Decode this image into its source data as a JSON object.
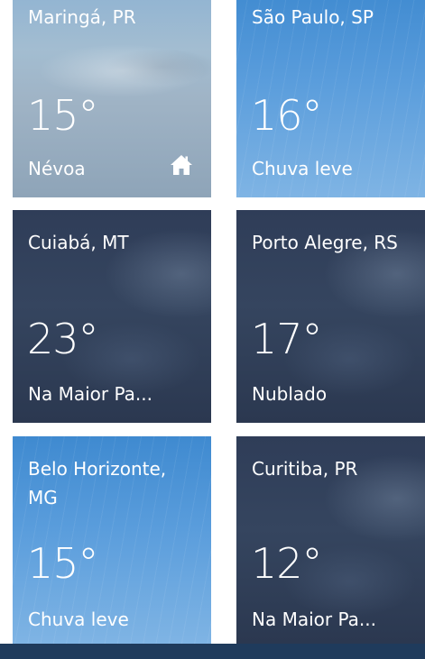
{
  "tiles": [
    {
      "city": "Maringá, PR",
      "temp": "15°",
      "condition": "Névoa",
      "home": true,
      "bg": "fog"
    },
    {
      "city": "São Paulo, SP",
      "temp": "16°",
      "condition": "Chuva leve",
      "home": false,
      "bg": "rain"
    },
    {
      "city": "Cuiabá, MT",
      "temp": "23°",
      "condition": "Na Maior Pa...",
      "home": false,
      "bg": "cloud"
    },
    {
      "city": "Porto Alegre, RS",
      "temp": "17°",
      "condition": "Nublado",
      "home": false,
      "bg": "cloud"
    },
    {
      "city": "Belo Horizonte, MG",
      "temp": "15°",
      "condition": "Chuva leve",
      "home": false,
      "bg": "rain"
    },
    {
      "city": "Curitiba, PR",
      "temp": "12°",
      "condition": "Na Maior Pa...",
      "home": false,
      "bg": "cloud"
    }
  ],
  "icons": {
    "home": "home-icon"
  }
}
